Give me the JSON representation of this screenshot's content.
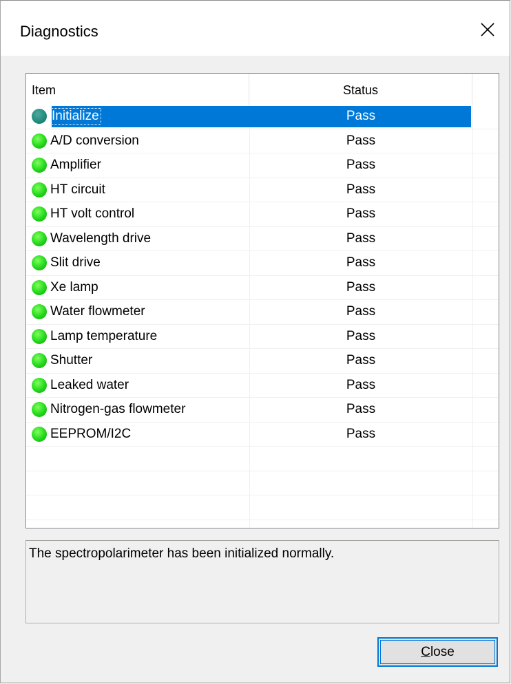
{
  "window": {
    "title": "Diagnostics",
    "close_icon": "close-icon"
  },
  "list": {
    "columns": [
      "Item",
      "Status"
    ],
    "rows": [
      {
        "item": "Initialize",
        "status": "Pass",
        "selected": true
      },
      {
        "item": "A/D conversion",
        "status": "Pass"
      },
      {
        "item": "Amplifier",
        "status": "Pass"
      },
      {
        "item": "HT circuit",
        "status": "Pass"
      },
      {
        "item": "HT volt control",
        "status": "Pass"
      },
      {
        "item": "Wavelength drive",
        "status": "Pass"
      },
      {
        "item": "Slit drive",
        "status": "Pass"
      },
      {
        "item": "Xe lamp",
        "status": "Pass"
      },
      {
        "item": "Water flowmeter",
        "status": "Pass"
      },
      {
        "item": "Lamp temperature",
        "status": "Pass"
      },
      {
        "item": "Shutter",
        "status": "Pass"
      },
      {
        "item": "Leaked water",
        "status": "Pass"
      },
      {
        "item": "Nitrogen-gas flowmeter",
        "status": "Pass"
      },
      {
        "item": "EEPROM/I2C",
        "status": "Pass"
      }
    ],
    "status_icon": "green-status-dot-icon"
  },
  "message": {
    "text": "The spectropolarimeter has been initialized normally."
  },
  "buttons": {
    "close_mnemonic": "C",
    "close_rest": "lose"
  },
  "colors": {
    "selection": "#0078d7",
    "status_ok": "#22d81a",
    "dialog_bg": "#f0f0f0"
  }
}
